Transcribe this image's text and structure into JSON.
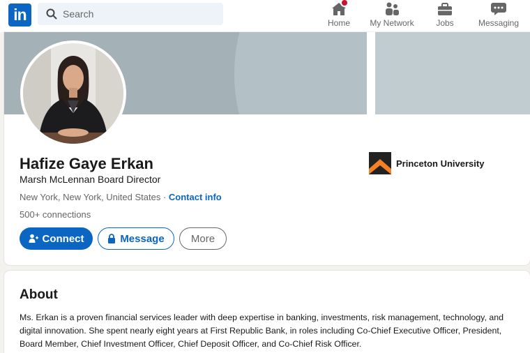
{
  "nav": {
    "logo": "in",
    "search_placeholder": "Search",
    "items": [
      {
        "label": "Home",
        "icon": "home-icon"
      },
      {
        "label": "My Network",
        "icon": "network-icon"
      },
      {
        "label": "Jobs",
        "icon": "briefcase-icon"
      },
      {
        "label": "Messaging",
        "icon": "messaging-icon"
      }
    ]
  },
  "profile": {
    "name": "Hafize Gaye Erkan",
    "headline": "Marsh McLennan Board Director",
    "location": "New York, New York, United States",
    "separator": " · ",
    "contact_info": "Contact info",
    "connections": "500+ connections",
    "education": "Princeton University",
    "buttons": {
      "connect": "Connect",
      "message": "Message",
      "more": "More"
    }
  },
  "about": {
    "title": "About",
    "text": "Ms. Erkan is a proven financial services leader with deep expertise in banking, investments, risk management, technology, and digital innovation. She spent nearly eight years at First Republic Bank, in roles including Co-Chief Executive Officer, President, Board Member, Chief Investment Officer, Chief Deposit Officer, and Co-Chief Risk Officer."
  },
  "colors": {
    "brand": "#0a66c2",
    "notification": "#cb112d",
    "princeton_orange": "#f58025"
  }
}
